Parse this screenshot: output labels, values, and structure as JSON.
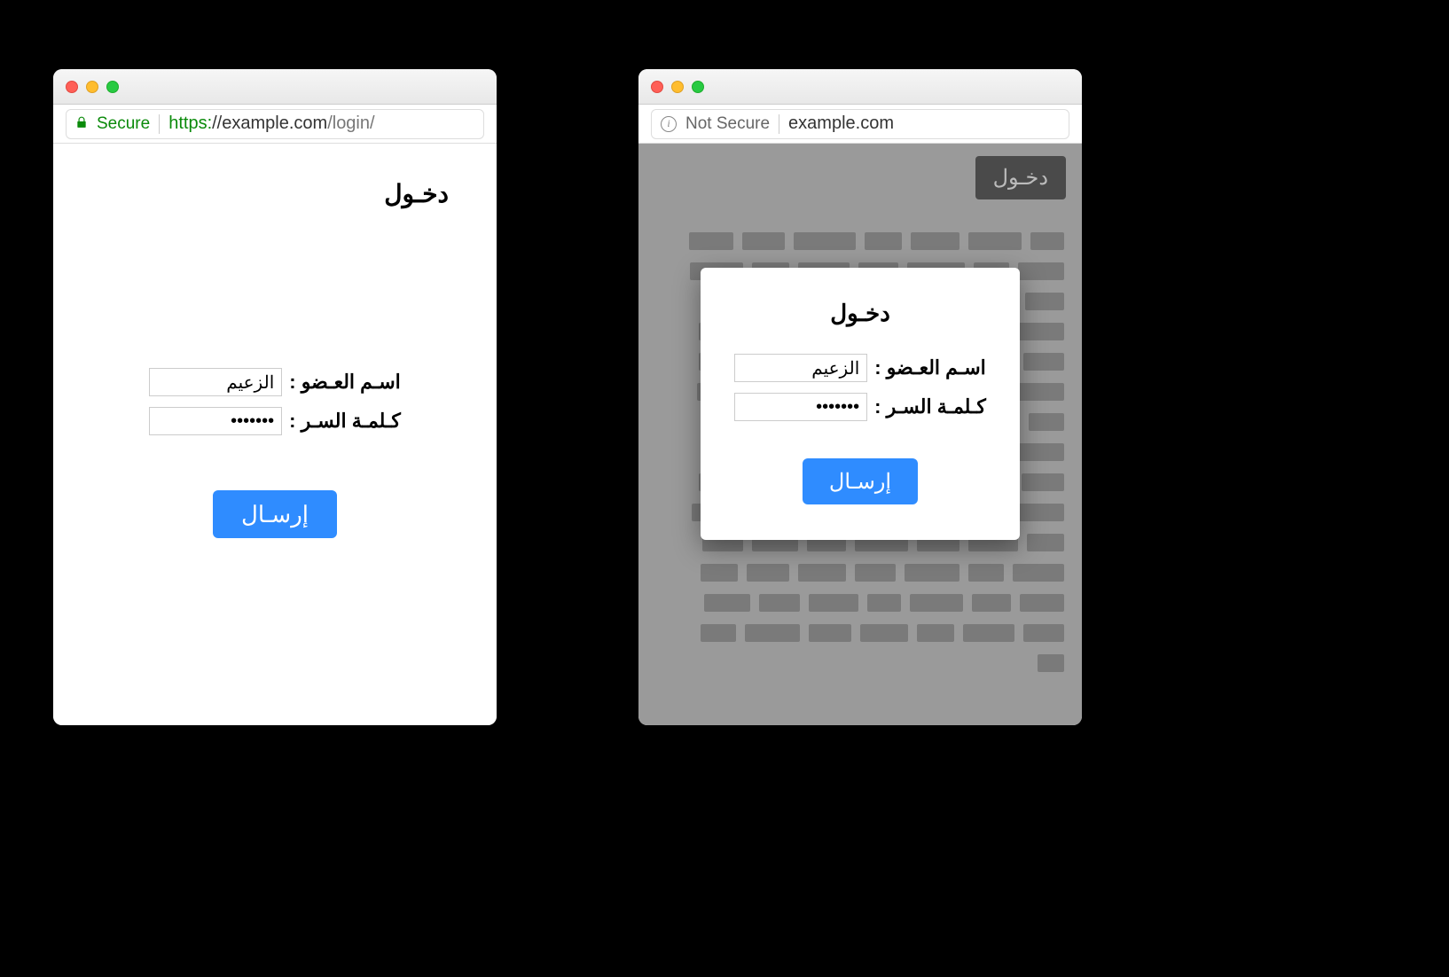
{
  "left_window": {
    "addressbar": {
      "secure_label": "Secure",
      "url_scheme": "https:",
      "url_host": "//example.com",
      "url_path": "/login/"
    },
    "page": {
      "title": "دخـول",
      "username_label": "اسـم العـضو :",
      "username_value": "الزعيم",
      "password_label": "كـلمـة السـر :",
      "password_value": "•••••••",
      "submit_label": "إرسـال"
    }
  },
  "right_window": {
    "addressbar": {
      "notsecure_label": "Not Secure",
      "url_host": "example.com"
    },
    "page": {
      "login_button_label": "دخـول",
      "popup": {
        "title": "دخـول",
        "username_label": "اسـم العـضو :",
        "username_value": "الزعيم",
        "password_label": "كـلمـة السـر :",
        "password_value": "•••••••",
        "submit_label": "إرسـال"
      }
    }
  }
}
